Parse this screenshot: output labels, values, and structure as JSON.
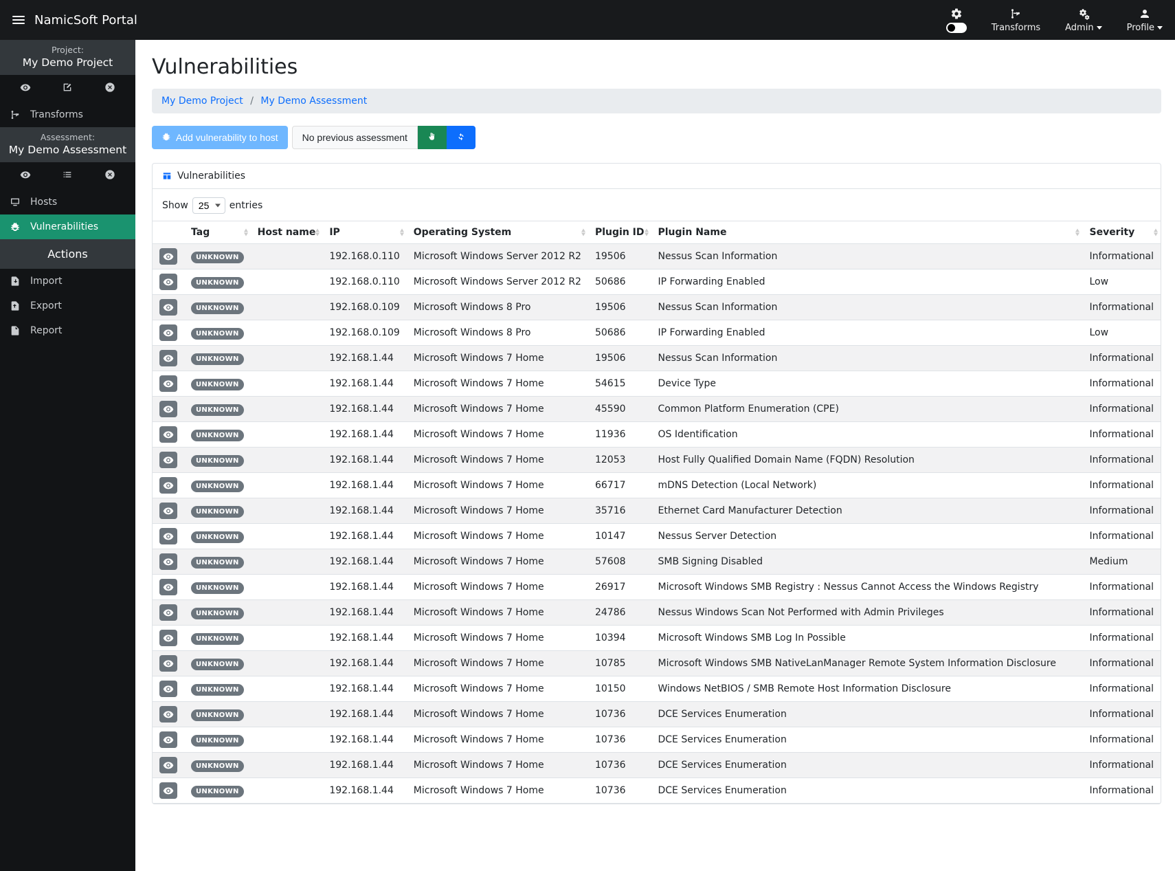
{
  "brand": "NamicSoft Portal",
  "topnav": {
    "transforms": "Transforms",
    "admin": "Admin",
    "profile": "Profile"
  },
  "sidebar": {
    "project_label": "Project:",
    "project_value": "My Demo Project",
    "transforms": "Transforms",
    "assessment_label": "Assessment:",
    "assessment_value": "My Demo Assessment",
    "hosts": "Hosts",
    "vulnerabilities": "Vulnerabilities",
    "actions_title": "Actions",
    "import": "Import",
    "export": "Export",
    "report": "Report"
  },
  "page": {
    "title": "Vulnerabilities",
    "breadcrumb1": "My Demo Project",
    "breadcrumb2": "My Demo Assessment"
  },
  "toolbar": {
    "add_vuln": "Add vulnerability to host",
    "no_prev": "No previous assessment"
  },
  "panel_title": "Vulnerabilities",
  "length": {
    "show": "Show",
    "value": "25",
    "entries": "entries"
  },
  "columns": {
    "tag": "Tag",
    "host": "Host name",
    "ip": "IP",
    "os": "Operating System",
    "pluginid": "Plugin ID",
    "pluginname": "Plugin Name",
    "severity": "Severity"
  },
  "tag_label": "UNKNOWN",
  "rows": [
    {
      "ip": "192.168.0.110",
      "os": "Microsoft Windows Server 2012 R2",
      "pid": "19506",
      "pname": "Nessus Scan Information",
      "sev": "Informational"
    },
    {
      "ip": "192.168.0.110",
      "os": "Microsoft Windows Server 2012 R2",
      "pid": "50686",
      "pname": "IP Forwarding Enabled",
      "sev": "Low"
    },
    {
      "ip": "192.168.0.109",
      "os": "Microsoft Windows 8 Pro",
      "pid": "19506",
      "pname": "Nessus Scan Information",
      "sev": "Informational"
    },
    {
      "ip": "192.168.0.109",
      "os": "Microsoft Windows 8 Pro",
      "pid": "50686",
      "pname": "IP Forwarding Enabled",
      "sev": "Low"
    },
    {
      "ip": "192.168.1.44",
      "os": "Microsoft Windows 7 Home",
      "pid": "19506",
      "pname": "Nessus Scan Information",
      "sev": "Informational"
    },
    {
      "ip": "192.168.1.44",
      "os": "Microsoft Windows 7 Home",
      "pid": "54615",
      "pname": "Device Type",
      "sev": "Informational"
    },
    {
      "ip": "192.168.1.44",
      "os": "Microsoft Windows 7 Home",
      "pid": "45590",
      "pname": "Common Platform Enumeration (CPE)",
      "sev": "Informational"
    },
    {
      "ip": "192.168.1.44",
      "os": "Microsoft Windows 7 Home",
      "pid": "11936",
      "pname": "OS Identification",
      "sev": "Informational"
    },
    {
      "ip": "192.168.1.44",
      "os": "Microsoft Windows 7 Home",
      "pid": "12053",
      "pname": "Host Fully Qualified Domain Name (FQDN) Resolution",
      "sev": "Informational"
    },
    {
      "ip": "192.168.1.44",
      "os": "Microsoft Windows 7 Home",
      "pid": "66717",
      "pname": "mDNS Detection (Local Network)",
      "sev": "Informational"
    },
    {
      "ip": "192.168.1.44",
      "os": "Microsoft Windows 7 Home",
      "pid": "35716",
      "pname": "Ethernet Card Manufacturer Detection",
      "sev": "Informational"
    },
    {
      "ip": "192.168.1.44",
      "os": "Microsoft Windows 7 Home",
      "pid": "10147",
      "pname": "Nessus Server Detection",
      "sev": "Informational"
    },
    {
      "ip": "192.168.1.44",
      "os": "Microsoft Windows 7 Home",
      "pid": "57608",
      "pname": "SMB Signing Disabled",
      "sev": "Medium"
    },
    {
      "ip": "192.168.1.44",
      "os": "Microsoft Windows 7 Home",
      "pid": "26917",
      "pname": "Microsoft Windows SMB Registry : Nessus Cannot Access the Windows Registry",
      "sev": "Informational"
    },
    {
      "ip": "192.168.1.44",
      "os": "Microsoft Windows 7 Home",
      "pid": "24786",
      "pname": "Nessus Windows Scan Not Performed with Admin Privileges",
      "sev": "Informational"
    },
    {
      "ip": "192.168.1.44",
      "os": "Microsoft Windows 7 Home",
      "pid": "10394",
      "pname": "Microsoft Windows SMB Log In Possible",
      "sev": "Informational"
    },
    {
      "ip": "192.168.1.44",
      "os": "Microsoft Windows 7 Home",
      "pid": "10785",
      "pname": "Microsoft Windows SMB NativeLanManager Remote System Information Disclosure",
      "sev": "Informational"
    },
    {
      "ip": "192.168.1.44",
      "os": "Microsoft Windows 7 Home",
      "pid": "10150",
      "pname": "Windows NetBIOS / SMB Remote Host Information Disclosure",
      "sev": "Informational"
    },
    {
      "ip": "192.168.1.44",
      "os": "Microsoft Windows 7 Home",
      "pid": "10736",
      "pname": "DCE Services Enumeration",
      "sev": "Informational"
    },
    {
      "ip": "192.168.1.44",
      "os": "Microsoft Windows 7 Home",
      "pid": "10736",
      "pname": "DCE Services Enumeration",
      "sev": "Informational"
    },
    {
      "ip": "192.168.1.44",
      "os": "Microsoft Windows 7 Home",
      "pid": "10736",
      "pname": "DCE Services Enumeration",
      "sev": "Informational"
    },
    {
      "ip": "192.168.1.44",
      "os": "Microsoft Windows 7 Home",
      "pid": "10736",
      "pname": "DCE Services Enumeration",
      "sev": "Informational"
    }
  ]
}
